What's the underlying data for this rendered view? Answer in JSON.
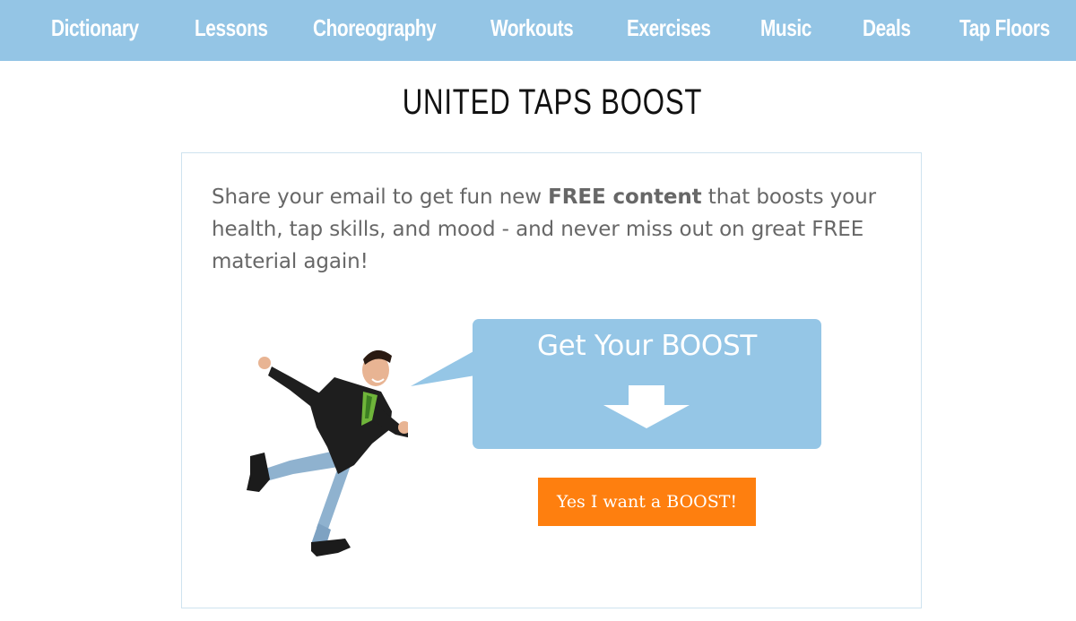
{
  "nav": {
    "items": [
      "Dictionary",
      "Lessons",
      "Choreography",
      "Workouts",
      "Exercises",
      "Music",
      "Deals",
      "Tap Floors"
    ]
  },
  "page": {
    "title": "UNITED TAPS BOOST"
  },
  "signup": {
    "intro_before": "Share your email to get fun new ",
    "intro_bold": "FREE content",
    "intro_after": " that boosts your health, tap skills, and mood - and never miss out on great FREE material again!",
    "bubble_text": "Get Your BOOST",
    "arrow_icon": "arrow-down-icon",
    "cta_label": "Yes I want a BOOST!"
  },
  "colors": {
    "nav_bg": "#94c5e5",
    "bubble_bg": "#95c6e6",
    "cta_bg": "#fe7f0f",
    "box_border": "#cfe3ef"
  }
}
